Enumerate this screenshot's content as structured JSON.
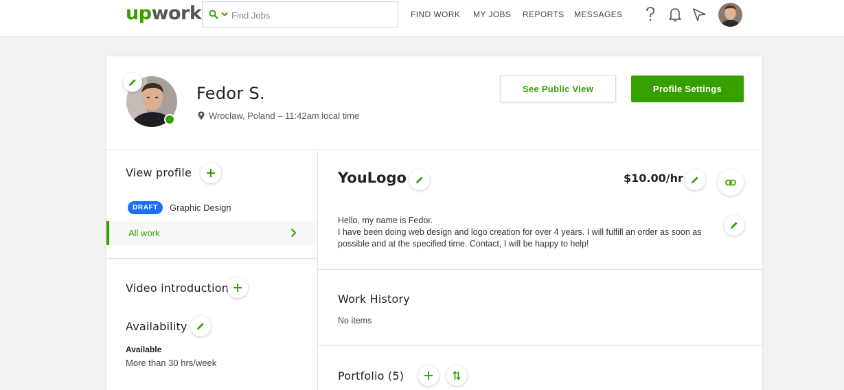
{
  "brand": {
    "logo_up": "up",
    "logo_work": "work",
    "accent": "#37a000"
  },
  "search": {
    "placeholder": "Find Jobs"
  },
  "nav": {
    "find_work": "FIND WORK",
    "my_jobs": "MY JOBS",
    "reports": "REPORTS",
    "messages": "MESSAGES"
  },
  "icons": [
    "search-icon",
    "chevron-down-icon",
    "help-icon",
    "bell-icon",
    "send-icon",
    "pencil-icon",
    "plus-icon",
    "location-pin-icon",
    "link-icon",
    "sort-icon",
    "chevron-right-icon"
  ],
  "profile": {
    "name": "Fedor S.",
    "location": "Wroclaw, Poland – 11:42am local time",
    "see_public_view": "See Public View",
    "profile_settings": "Profile Settings"
  },
  "sidebar": {
    "view_profile": "View profile",
    "draft_badge": "DRAFT",
    "draft_label": "Graphic Design",
    "all_work": "All work",
    "video_intro": "Video introduction",
    "availability": "Availability",
    "availability_status": "Available",
    "availability_hours": "More than 30 hrs/week"
  },
  "main": {
    "title": "YouLogo",
    "rate": "$10.00/hr",
    "bio_line1": "Hello, my name is Fedor.",
    "bio_line2": "I have been doing web design and logo creation for over 4 years. I will fulfill an order as soon as possible and at the specified time. Contact, I will be happy to help!",
    "work_history": "Work History",
    "no_items": "No items",
    "portfolio": "Portfolio (5)"
  }
}
